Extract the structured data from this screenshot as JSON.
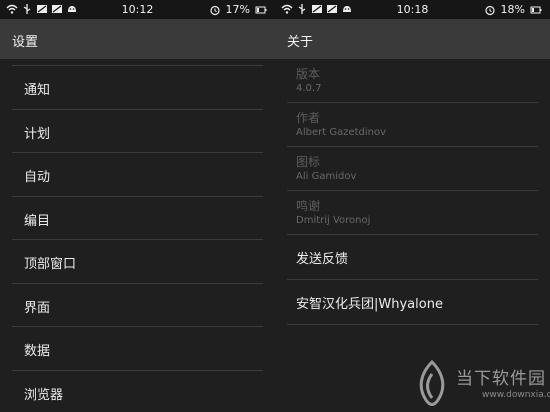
{
  "left": {
    "status": {
      "time": "10:12",
      "battery": "17%"
    },
    "title": "设置",
    "items": [
      "通知",
      "计划",
      "自动",
      "编目",
      "顶部窗口",
      "界面",
      "数据",
      "浏览器"
    ]
  },
  "right": {
    "status": {
      "time": "10:18",
      "battery": "18%"
    },
    "title": "关于",
    "info": [
      {
        "label": "版本",
        "value": "4.0.7"
      },
      {
        "label": "作者",
        "value": "Albert Gazetdinov"
      },
      {
        "label": "图标",
        "value": "Ali Gamidov"
      },
      {
        "label": "鸣谢",
        "value": "Dmitrij Voronoj"
      }
    ],
    "actions": [
      "发送反馈",
      "安智汉化兵团|Whyalone"
    ]
  },
  "watermark": {
    "title": "当下软件园",
    "url": "www.downxia.com"
  },
  "icons": {
    "status_left": [
      "wifi-icon",
      "usb-icon",
      "notification-icon",
      "android-icon"
    ],
    "status_right": [
      "alarm-icon",
      "battery-icon"
    ]
  },
  "colors": {
    "background": "#1f1f1f",
    "appbar": "#3a3a3a",
    "statusbar": "#161616",
    "divider": "#3b3b3b",
    "dim_text": "#5d5d5d"
  }
}
